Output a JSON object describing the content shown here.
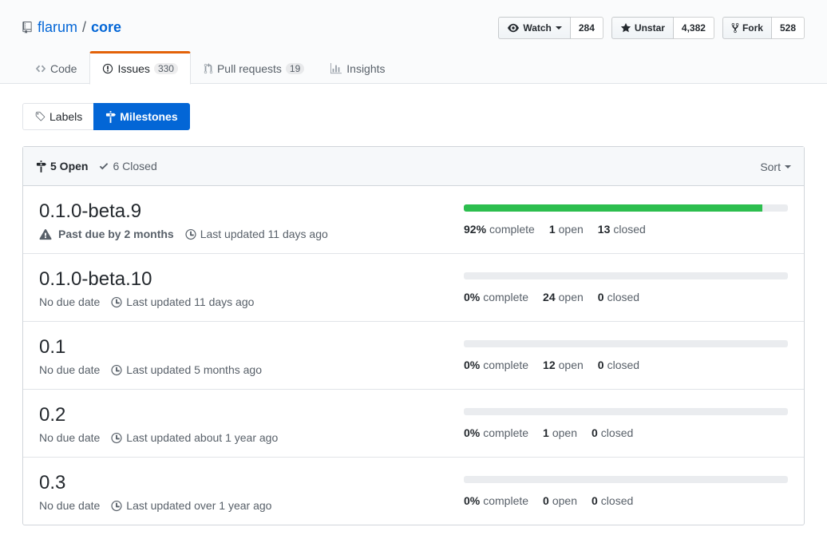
{
  "repo": {
    "owner": "flarum",
    "separator": "/",
    "name": "core"
  },
  "actions": {
    "watch_label": "Watch",
    "watch_count": "284",
    "star_label": "Unstar",
    "star_count": "4,382",
    "fork_label": "Fork",
    "fork_count": "528"
  },
  "reponav": {
    "code": "Code",
    "issues": "Issues",
    "issues_count": "330",
    "pulls": "Pull requests",
    "pulls_count": "19",
    "insights": "Insights"
  },
  "subnav": {
    "labels": "Labels",
    "milestones": "Milestones"
  },
  "states": {
    "open": "5 Open",
    "closed": "6 Closed",
    "sort": "Sort"
  },
  "milestones": [
    {
      "title": "0.1.0-beta.9",
      "due": "Past due by 2 months",
      "past_due": true,
      "updated": "Last updated 11 days ago",
      "percent_num": 92,
      "percent": "92%",
      "complete": "complete",
      "open_count": "1",
      "open_label": "open",
      "closed_count": "13",
      "closed_label": "closed"
    },
    {
      "title": "0.1.0-beta.10",
      "due": "No due date",
      "past_due": false,
      "updated": "Last updated 11 days ago",
      "percent_num": 0,
      "percent": "0%",
      "complete": "complete",
      "open_count": "24",
      "open_label": "open",
      "closed_count": "0",
      "closed_label": "closed"
    },
    {
      "title": "0.1",
      "due": "No due date",
      "past_due": false,
      "updated": "Last updated 5 months ago",
      "percent_num": 0,
      "percent": "0%",
      "complete": "complete",
      "open_count": "12",
      "open_label": "open",
      "closed_count": "0",
      "closed_label": "closed"
    },
    {
      "title": "0.2",
      "due": "No due date",
      "past_due": false,
      "updated": "Last updated about 1 year ago",
      "percent_num": 0,
      "percent": "0%",
      "complete": "complete",
      "open_count": "1",
      "open_label": "open",
      "closed_count": "0",
      "closed_label": "closed"
    },
    {
      "title": "0.3",
      "due": "No due date",
      "past_due": false,
      "updated": "Last updated over 1 year ago",
      "percent_num": 0,
      "percent": "0%",
      "complete": "complete",
      "open_count": "0",
      "open_label": "open",
      "closed_count": "0",
      "closed_label": "closed"
    }
  ],
  "colors": {
    "link": "#0366d6",
    "progress": "#2cbe4e",
    "tab_accent": "#e36209"
  }
}
